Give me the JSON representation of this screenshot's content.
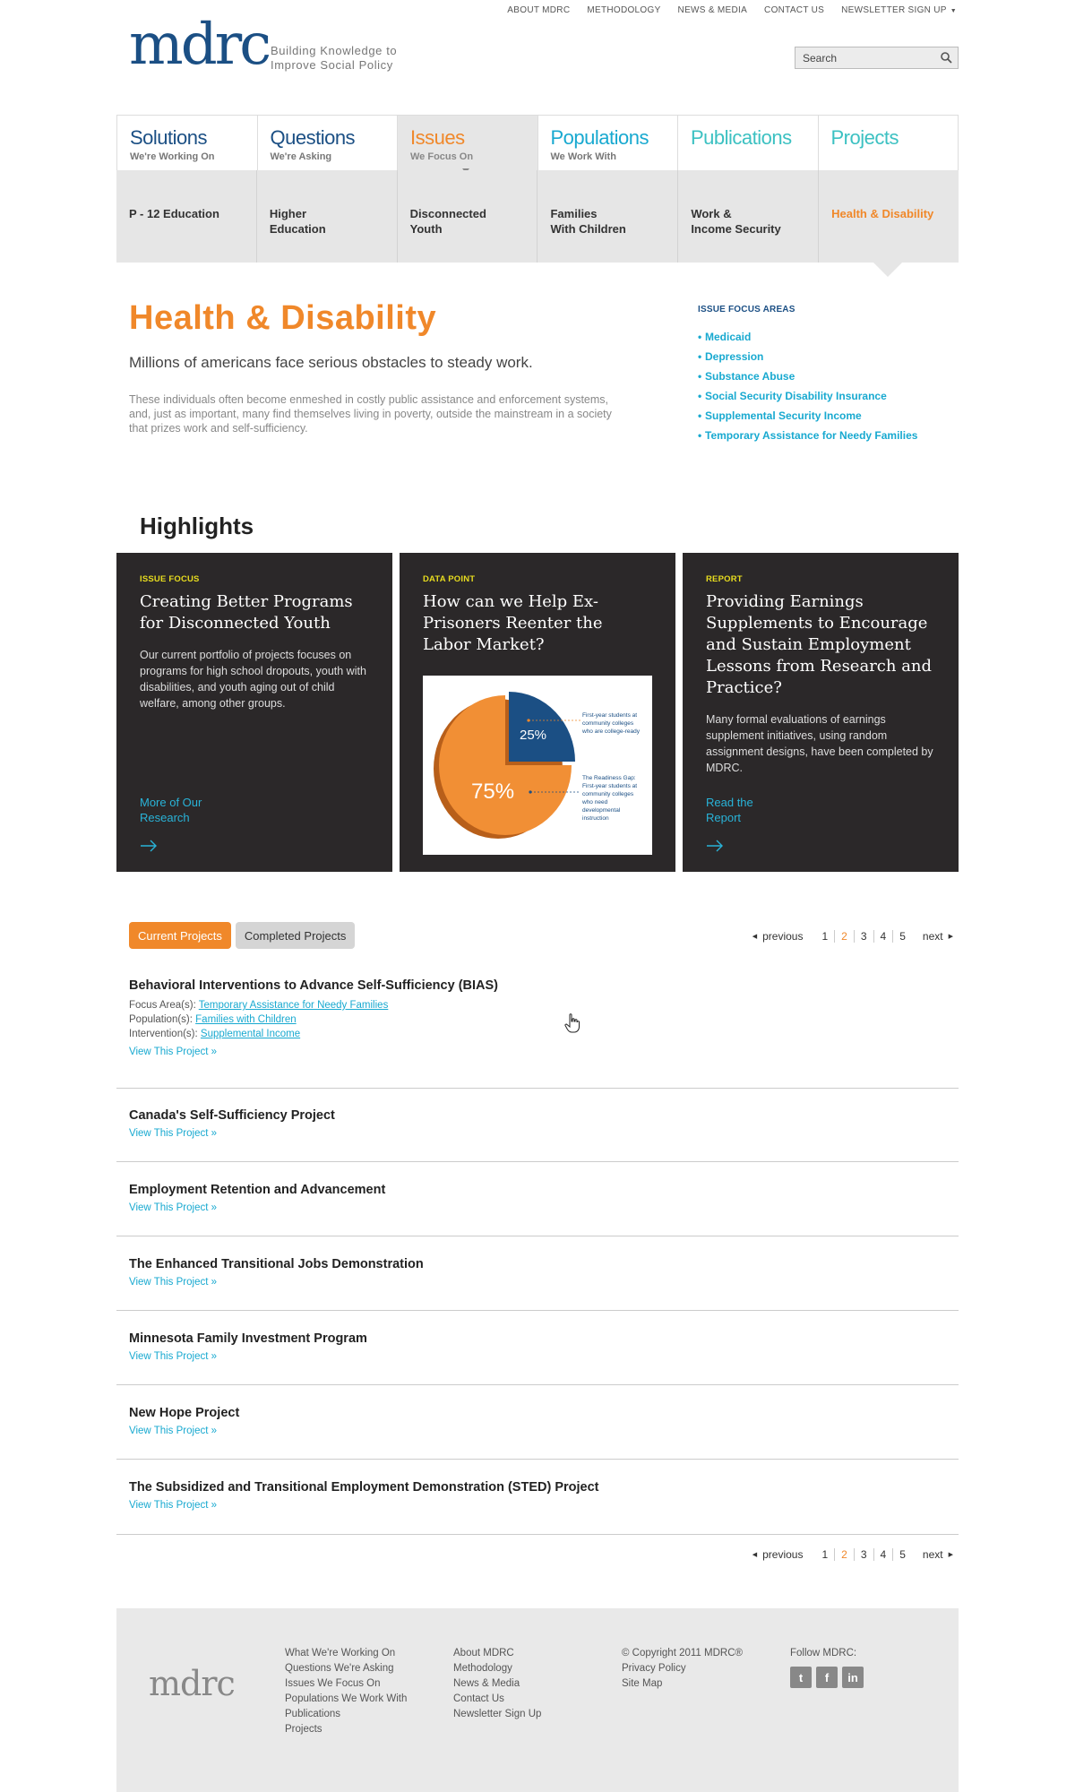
{
  "utility_nav": [
    "ABOUT MDRC",
    "METHODOLOGY",
    "NEWS & MEDIA",
    "CONTACT US",
    "NEWSLETTER SIGN UP"
  ],
  "brand": {
    "logo": "mdrc",
    "tagline": "Building Knowledge to Improve Social Policy"
  },
  "search": {
    "placeholder": "Search"
  },
  "main_nav": [
    {
      "label": "Solutions",
      "sub": "We're Working On",
      "color": "#1b4f84"
    },
    {
      "label": "Questions",
      "sub": "We're Asking",
      "color": "#1b4f84"
    },
    {
      "label": "Issues",
      "sub": "We Focus On",
      "color": "#f0882a"
    },
    {
      "label": "Populations",
      "sub": "We Work With",
      "color": "#18a9d0"
    },
    {
      "label": "Publications",
      "sub": "",
      "color": "#3cc1c2"
    },
    {
      "label": "Projects",
      "sub": "",
      "color": "#3cc1c2"
    }
  ],
  "sub_nav": [
    "P - 12 Education",
    "Higher\nEducation",
    "Disconnected\nYouth",
    "Families\nWith Children",
    "Work &\nIncome Security",
    "Health & Disability"
  ],
  "hero": {
    "title": "Health & Disability",
    "lead": "Millions of americans face serious obstacles to steady work.",
    "body": "These individuals often become enmeshed in costly public assistance and enforcement systems, and, just as important, many find themselves living in poverty, outside the mainstream in a society that prizes work and self-sufficiency."
  },
  "focus_areas": {
    "heading": "ISSUE FOCUS AREAS",
    "items": [
      "Medicaid",
      "Depression",
      "Substance Abuse",
      "Social Security Disability Insurance",
      "Supplemental Security Income",
      "Temporary Assistance for Needy Families"
    ]
  },
  "highlights": {
    "title": "Highlights",
    "cards": [
      {
        "kicker": "ISSUE FOCUS",
        "title": "Creating Better Programs for Disconnected Youth",
        "body": "Our current portfolio of projects focuses on programs for high school dropouts, youth with disabilities, and youth aging out of child welfare, among other groups.",
        "link": "More of Our\nResearch"
      },
      {
        "kicker": "DATA POINT",
        "title": "How can we Help Ex-Prisoners Reenter the Labor Market?",
        "pie": {
          "big": "75%",
          "small": "25%",
          "note1": "First-year students at community colleges who are college-ready",
          "note2": "The Readiness Gap: First-year students at community colleges who need developmental instruction"
        }
      },
      {
        "kicker": "REPORT",
        "title": "Providing Earnings Supplements to Encourage and Sustain Employment Lessons from Research and Practice?",
        "body": "Many formal evaluations of earnings supplement initiatives, using random assignment designs, have been completed by MDRC.",
        "link": "Read the\nReport"
      }
    ]
  },
  "projects": {
    "tabs": [
      "Current Projects",
      "Completed Projects"
    ],
    "pager": {
      "prev": "previous",
      "next": "next",
      "pages": [
        "1",
        "2",
        "3",
        "4",
        "5"
      ],
      "current": "2"
    },
    "meta_labels": {
      "focus": "Focus Area(s): ",
      "population": "Population(s): ",
      "intervention": "Intervention(s): "
    },
    "first_meta": {
      "focus": "Temporary Assistance for Needy Families",
      "population": "Families with Children",
      "intervention": "Supplemental Income"
    },
    "view_label": "View This Project »",
    "items": [
      "Behavioral Interventions to Advance Self-Sufficiency (BIAS)",
      "Canada's Self-Sufficiency Project",
      "Employment Retention and Advancement",
      "The Enhanced Transitional Jobs Demonstration",
      "Minnesota Family Investment Program",
      "New Hope Project",
      "The Subsidized and Transitional Employment Demonstration (STED) Project"
    ]
  },
  "footer": {
    "logo": "mdrc",
    "col1": [
      "What We're Working On",
      "Questions We're Asking",
      "Issues We Focus On",
      "Populations We Work With",
      "Publications",
      "Projects"
    ],
    "col2": [
      "About MDRC",
      "Methodology",
      "News & Media",
      "Contact Us",
      "Newsletter Sign Up"
    ],
    "col3": [
      "© Copyright 2011 MDRC®",
      "Privacy Policy",
      "Site Map"
    ],
    "follow": "Follow MDRC:",
    "social": [
      "twitter-icon",
      "facebook-icon",
      "linkedin-icon"
    ]
  }
}
